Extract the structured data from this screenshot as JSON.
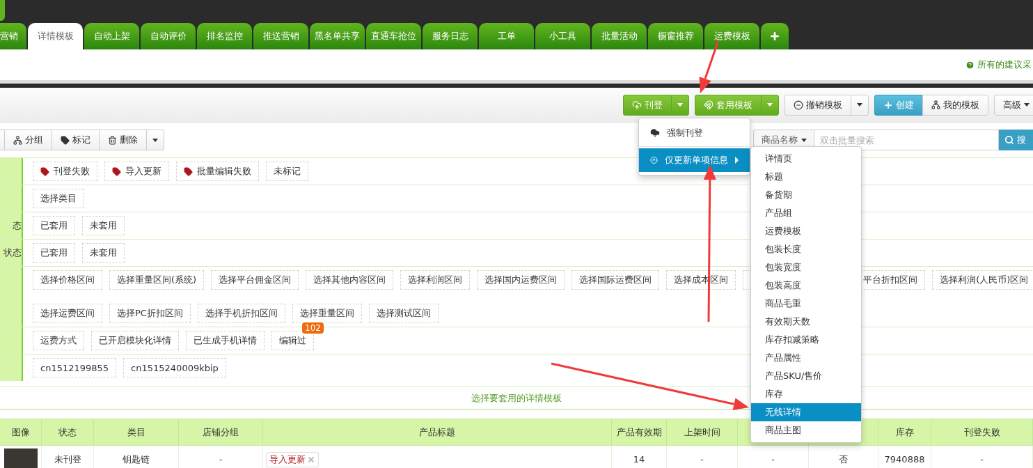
{
  "tabs": [
    {
      "label": "营销",
      "selected": false
    },
    {
      "label": "详情模板",
      "selected": true
    },
    {
      "label": "自动上架",
      "selected": false
    },
    {
      "label": "自动评价",
      "selected": false
    },
    {
      "label": "排名监控",
      "selected": false
    },
    {
      "label": "推送营销",
      "selected": false
    },
    {
      "label": "黑名单共享",
      "selected": false
    },
    {
      "label": "直通车抢位",
      "selected": false
    },
    {
      "label": "服务日志",
      "selected": false
    },
    {
      "label": "工单",
      "selected": false
    },
    {
      "label": "小工具",
      "selected": false
    },
    {
      "label": "批量活动",
      "selected": false
    },
    {
      "label": "橱窗推荐",
      "selected": false
    },
    {
      "label": "运费模板",
      "selected": false
    }
  ],
  "notice": {
    "text": "所有的建议采"
  },
  "toolbar": {
    "buttons": [
      {
        "label": "刊登",
        "kind": "publish"
      },
      {
        "label": "套用模板",
        "kind": "apply"
      },
      {
        "label": "撤销模板",
        "kind": "revoke"
      },
      {
        "label": "创建",
        "kind": "create"
      },
      {
        "label": "我的模板",
        "kind": "mine"
      },
      {
        "label": "高级",
        "kind": "advanced"
      }
    ]
  },
  "actions": [
    {
      "label": "分组",
      "kind": "group"
    },
    {
      "label": "标记",
      "kind": "mark"
    },
    {
      "label": "删除",
      "kind": "delete"
    }
  ],
  "search": {
    "field": "商品名称",
    "placeholder": "双击批量搜索",
    "button": "搜"
  },
  "filters": [
    {
      "chips": [
        {
          "label": "刊登失败",
          "kind": "tag"
        },
        {
          "label": "导入更新",
          "kind": "tag"
        },
        {
          "label": "批量编辑失败",
          "kind": "tag"
        },
        {
          "label": "未标记",
          "kind": "plain"
        }
      ]
    },
    {
      "chips": [
        {
          "label": "选择类目",
          "kind": "plain"
        }
      ]
    },
    {
      "label": "态",
      "chips": [
        {
          "label": "已套用",
          "kind": "plain"
        },
        {
          "label": "未套用",
          "kind": "plain"
        }
      ]
    },
    {
      "label": "状态",
      "chips": [
        {
          "label": "已套用",
          "kind": "plain"
        },
        {
          "label": "未套用",
          "kind": "plain"
        }
      ]
    },
    {
      "chips": [
        {
          "label": "选择价格区间",
          "kind": "plain"
        },
        {
          "label": "选择重量区间(系统)",
          "kind": "plain"
        },
        {
          "label": "选择平台佣金区间",
          "kind": "plain"
        },
        {
          "label": "选择其他内容区间",
          "kind": "plain"
        },
        {
          "label": "选择利润区间",
          "kind": "plain"
        },
        {
          "label": "选择国内运费区间",
          "kind": "plain"
        },
        {
          "label": "选择国际运费区间",
          "kind": "plain"
        },
        {
          "label": "选择成本区间",
          "kind": "plain"
        },
        {
          "label": "平台折扣区间",
          "kind": "covered"
        },
        {
          "label": "选择利润(人民币)区间",
          "kind": "plain"
        },
        {
          "label": "选择运费区间",
          "kind": "plain",
          "new_line": true
        },
        {
          "label": "选择PC折扣区间",
          "kind": "plain"
        },
        {
          "label": "选择手机折扣区间",
          "kind": "plain"
        },
        {
          "label": "选择重量区间",
          "kind": "plain"
        },
        {
          "label": "选择测试区间",
          "kind": "plain"
        }
      ]
    },
    {
      "chips": [
        {
          "label": "运费方式",
          "kind": "plain"
        },
        {
          "label": "已开启模块化详情",
          "kind": "plain"
        },
        {
          "label": "已生成手机详情",
          "kind": "plain"
        },
        {
          "label": "编辑过",
          "kind": "plain",
          "badge": "102"
        }
      ]
    },
    {
      "chips": [
        {
          "label": "cn1512199855",
          "kind": "plain"
        },
        {
          "label": "cn1515240009kbip",
          "kind": "plain"
        }
      ]
    }
  ],
  "hint": "选择要套用的详情模板",
  "table": {
    "columns": [
      {
        "label": "图像"
      },
      {
        "label": "状态"
      },
      {
        "label": "类目"
      },
      {
        "label": "店铺分组"
      },
      {
        "label": "产品标题"
      },
      {
        "label": "产品有效期"
      },
      {
        "label": "上架时间"
      },
      {},
      {},
      {
        "label": "库存"
      },
      {
        "label": "刊登失败"
      }
    ],
    "rows": [
      {
        "status": "未刊登",
        "category": "钥匙链",
        "shop_group": "-",
        "title_tag": "导入更新",
        "validity": "14",
        "listed_time": "-",
        "column_8": "-",
        "column_9": "否",
        "stock": "7940888",
        "failure_reason": "-"
      }
    ]
  },
  "publish_menu": {
    "items": [
      {
        "label": "强制刊登",
        "kind": "force",
        "selected": false
      },
      {
        "label": "仅更新单项信息",
        "kind": "update",
        "selected": true
      }
    ]
  },
  "submenu": {
    "items": [
      {
        "label": "详情页",
        "selected": false
      },
      {
        "label": "标题",
        "selected": false
      },
      {
        "label": "备货期",
        "selected": false
      },
      {
        "label": "产品组",
        "selected": false
      },
      {
        "label": "运费模板",
        "selected": false
      },
      {
        "label": "包装长度",
        "selected": false
      },
      {
        "label": "包装宽度",
        "selected": false
      },
      {
        "label": "包装高度",
        "selected": false
      },
      {
        "label": "商品毛重",
        "selected": false
      },
      {
        "label": "有效期天数",
        "selected": false
      },
      {
        "label": "库存扣减策略",
        "selected": false
      },
      {
        "label": "产品属性",
        "selected": false
      },
      {
        "label": "产品SKU/售价",
        "selected": false
      },
      {
        "label": "库存",
        "selected": false
      },
      {
        "label": "无线详情",
        "selected": true
      },
      {
        "label": "商品主图",
        "selected": false
      }
    ]
  }
}
